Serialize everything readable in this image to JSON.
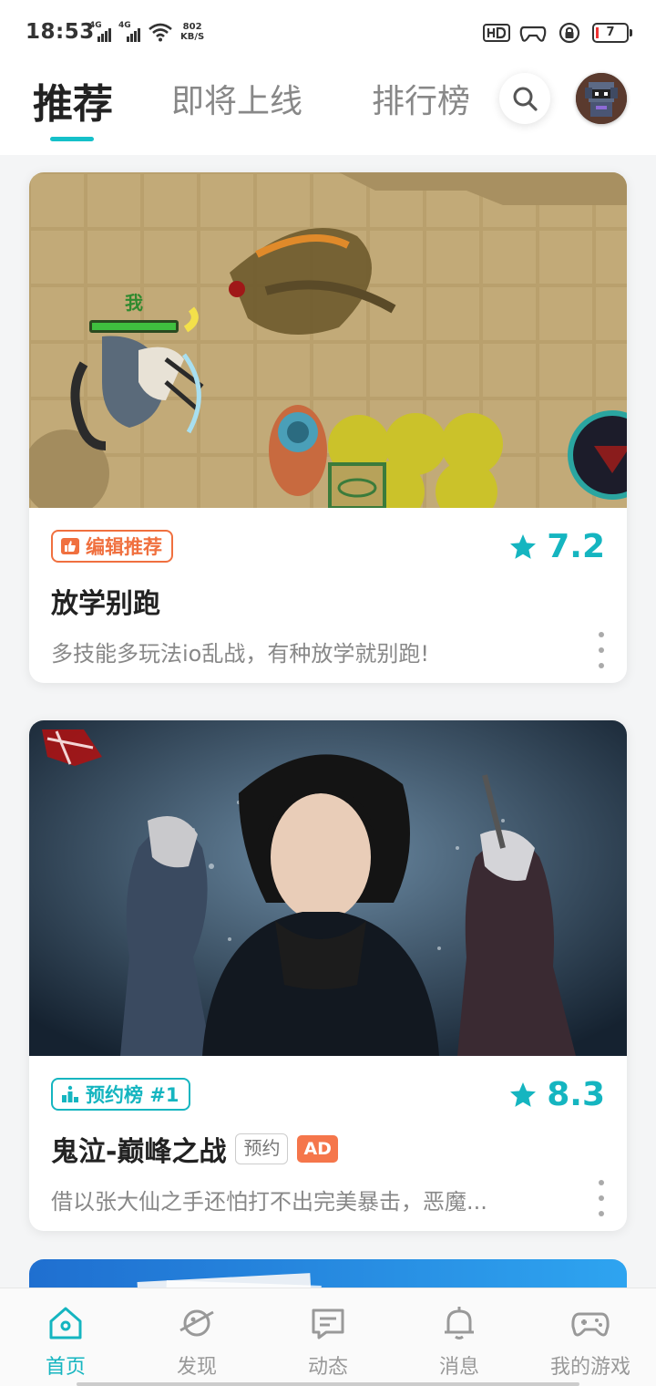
{
  "status_bar": {
    "time": "18:53",
    "network": [
      "4G",
      "4G"
    ],
    "speed_value": "802",
    "speed_unit": "KB/S",
    "battery": "7"
  },
  "header": {
    "tabs": [
      {
        "label": "推荐",
        "active": true
      },
      {
        "label": "即将上线",
        "active": false
      },
      {
        "label": "排行榜",
        "active": false
      }
    ]
  },
  "cards": [
    {
      "tag": "编辑推荐",
      "rating": "7.2",
      "title": "放学别跑",
      "description": "多技能多玩法io乱战，有种放学就别跑!",
      "scene_label": "我"
    },
    {
      "tag": "预约榜 #1",
      "rating": "8.3",
      "title": "鬼泣-巅峰之战",
      "badge": "预约",
      "ad": "AD",
      "description": "借以张大仙之手还怕打不出完美暴击，恶魔..."
    }
  ],
  "bottom_nav": [
    {
      "label": "首页",
      "icon": "home-icon",
      "active": true
    },
    {
      "label": "发现",
      "icon": "planet-icon",
      "active": false
    },
    {
      "label": "动态",
      "icon": "chat-icon",
      "active": false
    },
    {
      "label": "消息",
      "icon": "bell-icon",
      "active": false
    },
    {
      "label": "我的游戏",
      "icon": "gamepad-icon",
      "active": false
    }
  ],
  "colors": {
    "accent": "#15b5c0",
    "editor_tag": "#f0703f",
    "ad_badge": "#f5764b"
  }
}
